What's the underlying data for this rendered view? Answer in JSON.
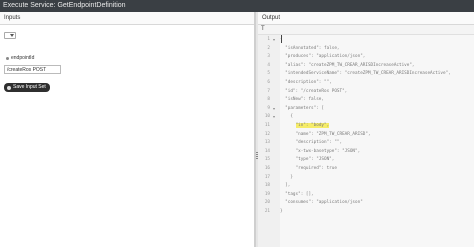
{
  "title": "Execute Service: GetEndpointDefinition",
  "inputs": {
    "header": "Inputs",
    "select_value": "",
    "param_label": "endpointId",
    "param_value": "/createRos POST",
    "save_label": "Save Input Set"
  },
  "output": {
    "header": "Output",
    "format_icon": "T",
    "lines": [
      {
        "n": "1",
        "text": "{",
        "fold": "▾"
      },
      {
        "n": "2",
        "text": "  \"isAnnotated\": false,"
      },
      {
        "n": "3",
        "text": "  \"produces\": \"application/json\","
      },
      {
        "n": "4",
        "text": "  \"alias\": \"createZPM_TW_CREAR_ARISDIncreaseActive\","
      },
      {
        "n": "5",
        "text": "  \"intendedServiceName\": \"createZPM_TW_CREAR_ARISDIncreaseActive\","
      },
      {
        "n": "6",
        "text": "  \"description\": \"\","
      },
      {
        "n": "7",
        "text": "  \"id\": \"/createRos POST\","
      },
      {
        "n": "8",
        "text": "  \"isNew\": false,"
      },
      {
        "n": "9",
        "text": "  \"parameters\": [",
        "fold": "▾"
      },
      {
        "n": "10",
        "text": "    {",
        "fold": "▾"
      },
      {
        "n": "11",
        "text": "      \"in\": \"body\",",
        "highlight": true
      },
      {
        "n": "12",
        "text": "      \"name\": \"ZPM_TW_CREAR_ARISD\","
      },
      {
        "n": "13",
        "text": "      \"description\": \"\","
      },
      {
        "n": "14",
        "text": "      \"x-twx-basetype\": \"JSON\","
      },
      {
        "n": "15",
        "text": "      \"type\": \"JSON\","
      },
      {
        "n": "16",
        "text": "      \"required\": true"
      },
      {
        "n": "17",
        "text": "    }"
      },
      {
        "n": "18",
        "text": "  ],"
      },
      {
        "n": "19",
        "text": "  \"tags\": [],"
      },
      {
        "n": "20",
        "text": "  \"consumes\": \"application/json\""
      },
      {
        "n": "21",
        "text": "}"
      }
    ]
  }
}
